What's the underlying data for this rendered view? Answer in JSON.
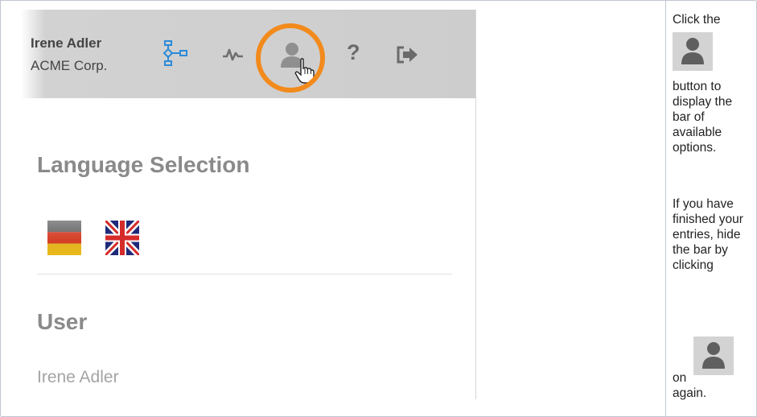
{
  "header": {
    "user_name": "Irene Adler",
    "organization": "ACME Corp."
  },
  "toolbar": {
    "icons": [
      "workflow-icon",
      "activity-icon",
      "user-icon",
      "help-icon",
      "logout-icon"
    ],
    "help_glyph": "?"
  },
  "content": {
    "language_title": "Language Selection",
    "languages": [
      "german-flag-icon",
      "uk-flag-icon"
    ],
    "user_title": "User",
    "user_value": "Irene Adler"
  },
  "instructions": {
    "line1": "Click the",
    "line2": "button to display the bar of available options.",
    "line3": "If you have finished your entries, hide the bar by clicking",
    "line4": "on",
    "line5": "again."
  },
  "colors": {
    "highlight": "#f28a1c",
    "toolbar_bg": "#cdcdcd",
    "icon_blue": "#2b8ad8",
    "icon_gray": "#7a7a7a"
  }
}
